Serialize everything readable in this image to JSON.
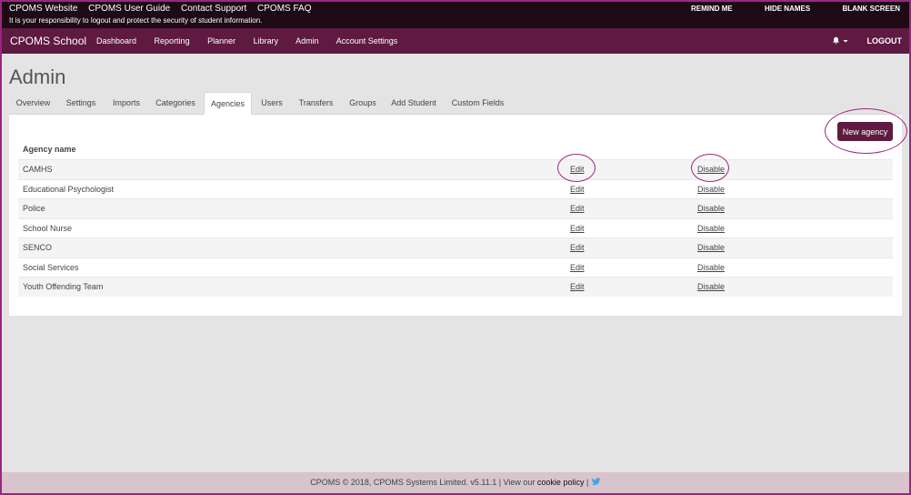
{
  "topbar": {
    "links": [
      "CPOMS Website",
      "CPOMS User Guide",
      "Contact Support",
      "CPOMS FAQ"
    ],
    "notice": "It is your responsibility to logout and protect the security of student information.",
    "remind_me": "REMIND ME",
    "hide_names": "HIDE NAMES",
    "blank_screen": "BLANK SCREEN"
  },
  "navbar": {
    "brand": "CPOMS School",
    "links": [
      "Dashboard",
      "Reporting",
      "Planner",
      "Library",
      "Admin",
      "Account Settings"
    ],
    "bell_icon": "bell-icon",
    "logout": "LOGOUT"
  },
  "page": {
    "title": "Admin"
  },
  "tabs": [
    "Overview",
    "Settings",
    "Imports",
    "Categories",
    "Agencies",
    "Users",
    "Transfers",
    "Groups",
    "Add Student",
    "Custom Fields"
  ],
  "active_tab": "Agencies",
  "agencies": {
    "new_button": "New agency",
    "header": "Agency name",
    "rows": [
      {
        "name": "CAMHS",
        "edit": "Edit",
        "disable": "Disable"
      },
      {
        "name": "Educational Psychologist",
        "edit": "Edit",
        "disable": "Disable"
      },
      {
        "name": "Police",
        "edit": "Edit",
        "disable": "Disable"
      },
      {
        "name": "School Nurse",
        "edit": "Edit",
        "disable": "Disable"
      },
      {
        "name": "SENCO",
        "edit": "Edit",
        "disable": "Disable"
      },
      {
        "name": "Social Services",
        "edit": "Edit",
        "disable": "Disable"
      },
      {
        "name": "Youth Offending Team",
        "edit": "Edit",
        "disable": "Disable"
      }
    ]
  },
  "footer": {
    "text": "CPOMS © 2018, CPOMS Systems Limited. v5.11.1 | View our ",
    "cookie": "cookie policy",
    "sep": " | ",
    "twitter_icon": "twitter-icon"
  },
  "colors": {
    "topbar": "#1d0a15",
    "navbar": "#5e1a40",
    "accent_ring": "#a0277f",
    "footer": "#d7c4cd"
  }
}
